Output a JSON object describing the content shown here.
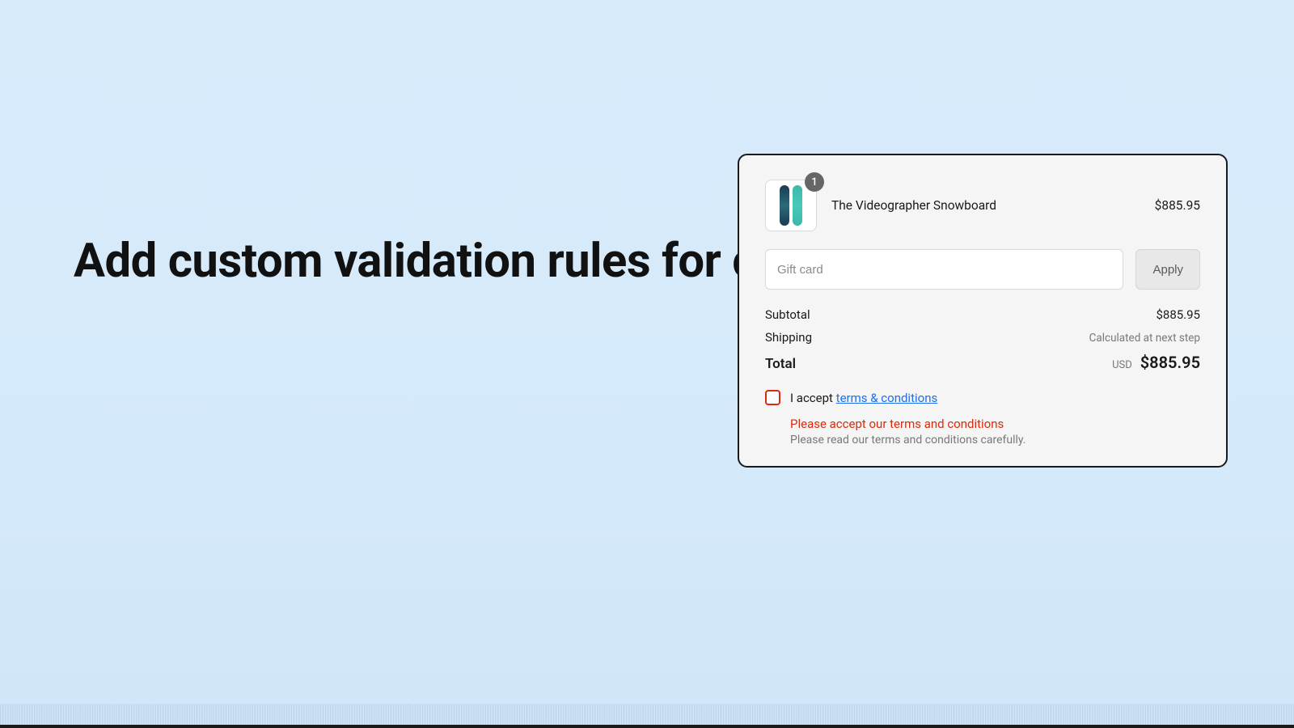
{
  "headline": "Add custom validation rules for consent fields",
  "cart": {
    "quantity": "1",
    "title": "The Videographer Snowboard",
    "price": "$885.95"
  },
  "gift": {
    "placeholder": "Gift card",
    "apply": "Apply"
  },
  "summary": {
    "subtotal_label": "Subtotal",
    "subtotal_value": "$885.95",
    "shipping_label": "Shipping",
    "shipping_value": "Calculated at next step",
    "total_label": "Total",
    "currency": "USD",
    "total_value": "$885.95"
  },
  "consent": {
    "prefix": "I accept ",
    "link": "terms & conditions",
    "error": "Please accept our terms and conditions",
    "hint": "Please read our terms and conditions carefully."
  }
}
